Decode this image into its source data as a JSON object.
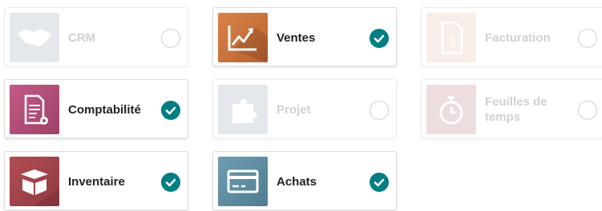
{
  "apps": [
    {
      "label": "CRM",
      "selected": false,
      "icon": "handshake-icon",
      "color": "#8a94a7"
    },
    {
      "label": "Ventes",
      "selected": true,
      "icon": "line-chart-icon",
      "color": "#c8703c"
    },
    {
      "label": "Facturation",
      "selected": false,
      "icon": "invoice-dollar-icon",
      "color": "#c8703c"
    },
    {
      "label": "Comptabilité",
      "selected": true,
      "icon": "document-gear-icon",
      "color": "#b5547a"
    },
    {
      "label": "Projet",
      "selected": false,
      "icon": "puzzle-icon",
      "color": "#8a94a7"
    },
    {
      "label": "Feuilles de temps",
      "selected": false,
      "icon": "stopwatch-icon",
      "color": "#a04f56"
    },
    {
      "label": "Inventaire",
      "selected": true,
      "icon": "box-icon",
      "color": "#a0454b"
    },
    {
      "label": "Achats",
      "selected": true,
      "icon": "credit-card-icon",
      "color": "#5b8ba0"
    }
  ],
  "colors": {
    "check_selected": "#017e84"
  }
}
